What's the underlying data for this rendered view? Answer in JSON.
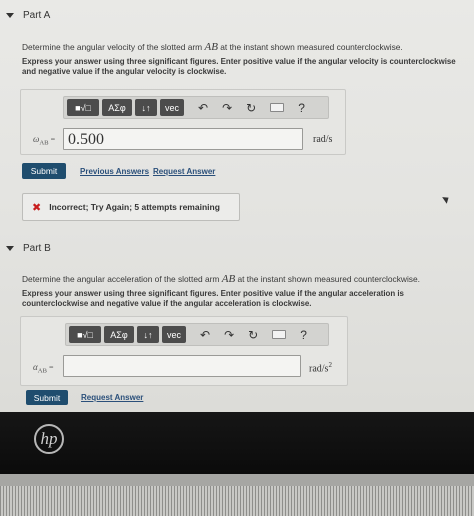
{
  "partA": {
    "title": "Part A",
    "prompt_pre": "Determine the angular velocity of the slotted arm ",
    "prompt_var": "AB",
    "prompt_post": " at the instant shown measured counterclockwise.",
    "instruction_1": "Express your answer using three significant figures. Enter positive value if the angular velocity is counterclockwise",
    "instruction_2": "and negative value if the angular velocity is clockwise.",
    "toolbar": {
      "templates": "■√□",
      "greek": "ΑΣφ",
      "arrows": "↓↑",
      "vec": "vec",
      "undo": "↶",
      "redo": "↷",
      "reset": "↻",
      "help": "?"
    },
    "label_sym": "ω",
    "label_sub": "AB",
    "label_eq": " =",
    "input_value": "0.500",
    "unit": "rad/s",
    "submit": "Submit",
    "previous_answers": "Previous Answers",
    "request_answer": "Request Answer",
    "feedback_icon": "✖",
    "feedback": "Incorrect; Try Again; 5 attempts remaining"
  },
  "partB": {
    "title": "Part B",
    "prompt_pre": "Determine the angular acceleration of the slotted arm ",
    "prompt_var": "AB",
    "prompt_post": " at the instant shown measured counterclockwise.",
    "instruction_1": "Express your answer using three significant figures. Enter positive value if the angular acceleration is",
    "instruction_2": "counterclockwise and negative value if the angular acceleration is clockwise.",
    "toolbar": {
      "templates": "■√□",
      "greek": "ΑΣφ",
      "arrows": "↓↑",
      "vec": "vec",
      "undo": "↶",
      "redo": "↷",
      "reset": "↻",
      "help": "?"
    },
    "label_sym": "α",
    "label_sub": "AB",
    "label_eq": " =",
    "input_value": "",
    "unit": "rad/s",
    "unit_sup": "2",
    "submit": "Submit",
    "request_answer": "Request Answer"
  },
  "device": {
    "logo": "hp"
  }
}
